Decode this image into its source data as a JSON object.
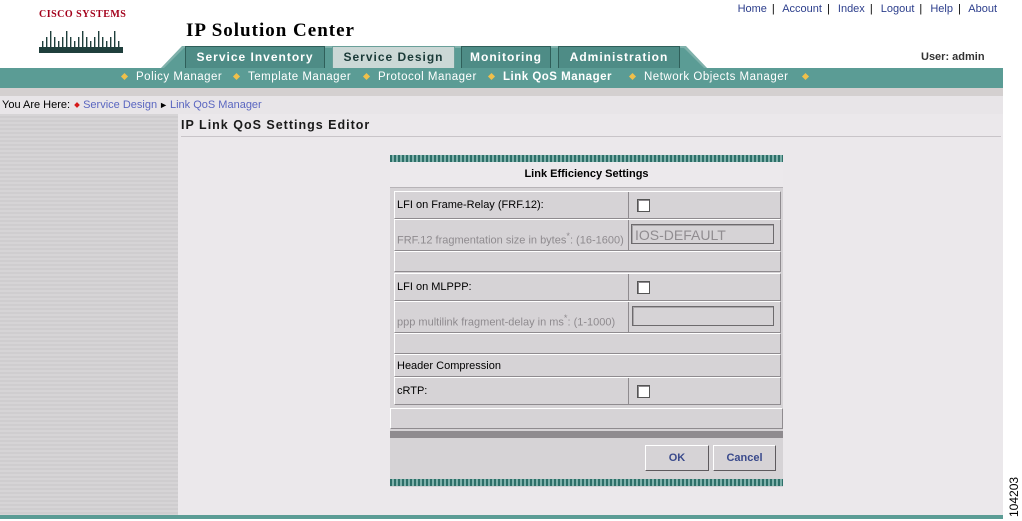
{
  "brand": {
    "logo_text": "Cisco Systems",
    "app_title": "IP Solution Center"
  },
  "top_links": [
    "Home",
    "Account",
    "Index",
    "Logout",
    "Help",
    "About"
  ],
  "user": {
    "label": "User: admin"
  },
  "tabs": [
    {
      "label": "Service Inventory",
      "active": false
    },
    {
      "label": "Service Design",
      "active": true
    },
    {
      "label": "Monitoring",
      "active": false
    },
    {
      "label": "Administration",
      "active": false
    }
  ],
  "subnav": [
    {
      "label": "Policy Manager",
      "active": false
    },
    {
      "label": "Template Manager",
      "active": false
    },
    {
      "label": "Protocol Manager",
      "active": false
    },
    {
      "label": "Link QoS Manager",
      "active": true
    },
    {
      "label": "Network Objects Manager",
      "active": false
    }
  ],
  "breadcrumb": {
    "label": "You Are Here:",
    "items": [
      "Service Design",
      "Link QoS Manager"
    ]
  },
  "page": {
    "title": "IP Link QoS Settings Editor"
  },
  "panel": {
    "title": "Link Efficiency Settings",
    "lfi_frf_label": "LFI on Frame-Relay (FRF.12):",
    "frf_size_label": "FRF.12 fragmentation size in bytes",
    "frf_size_range": ": (16-1600)",
    "frf_size_value": "IOS-DEFAULT",
    "lfi_mlppp_label": "LFI on MLPPP:",
    "ppp_delay_label": "ppp multilink fragment-delay in ms",
    "ppp_delay_range": ": (1-1000)",
    "ppp_delay_value": "",
    "header_compression_label": "Header Compression",
    "crtp_label": "cRTP:",
    "required_mark": "*"
  },
  "buttons": {
    "ok": "OK",
    "cancel": "Cancel"
  },
  "figure_id": "104203",
  "colors": {
    "teal": "#5b9c95",
    "tab_teal": "#4e8c86",
    "cisco_red": "#a3001b",
    "link_blue": "#2c3e8c"
  }
}
